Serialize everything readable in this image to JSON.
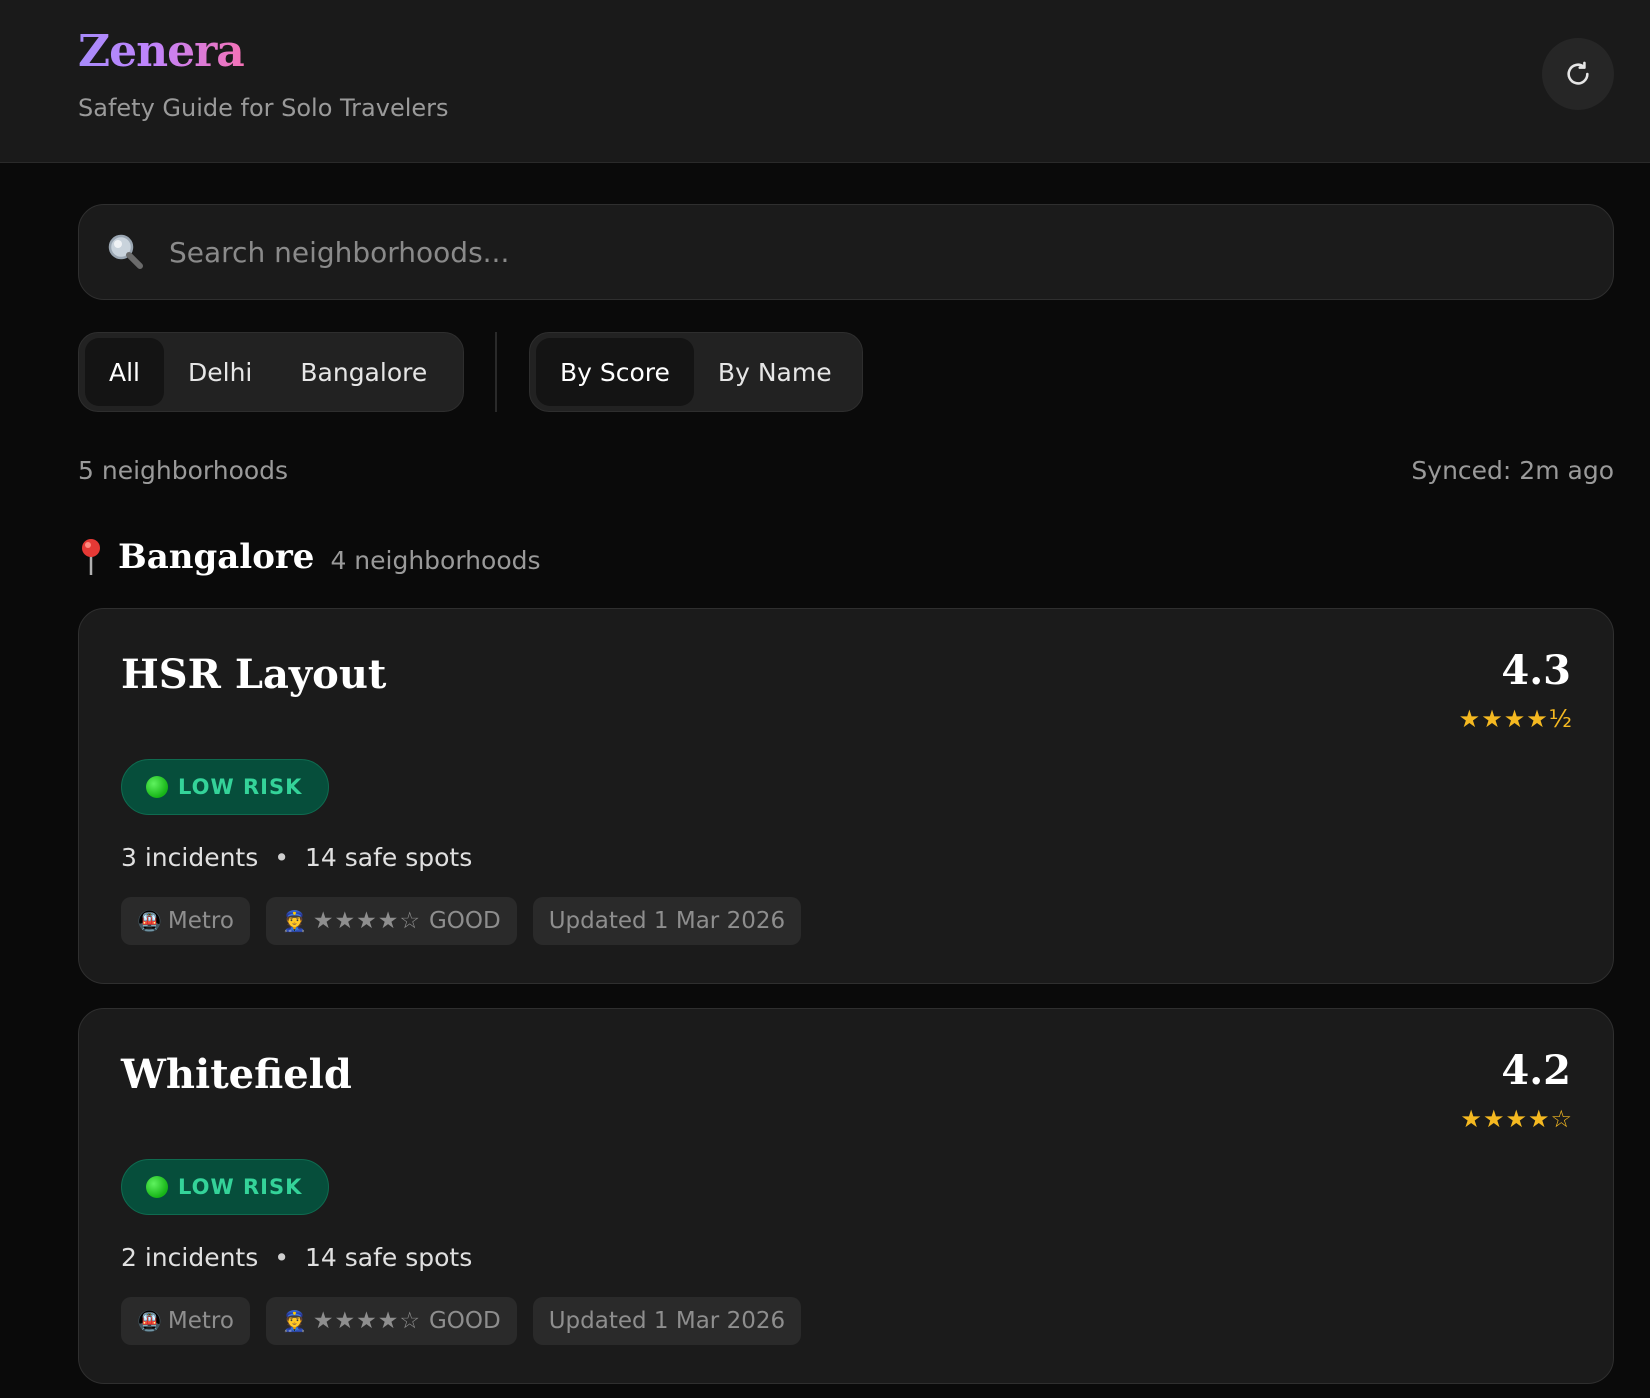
{
  "app": {
    "brand": "Zenera",
    "tagline": "Safety Guide for Solo Travelers"
  },
  "header": {
    "refresh_icon": "refresh-icon"
  },
  "search": {
    "placeholder": "Search neighborhoods...",
    "value": "",
    "icon": "search-icon"
  },
  "city_filter": {
    "options": [
      "All",
      "Delhi",
      "Bangalore"
    ],
    "selected": "All"
  },
  "sort_filter": {
    "options": [
      "By Score",
      "By Name"
    ],
    "selected": "By Score"
  },
  "summary": {
    "count_label": "5 neighborhoods",
    "synced_label": "Synced: 2m ago"
  },
  "group": {
    "city": "Bangalore",
    "count_label": "4 neighborhoods",
    "icon": "pin-icon"
  },
  "neighborhoods": [
    {
      "name": "HSR Layout",
      "score": "4.3",
      "stars": "★★★★½",
      "risk": "LOW RISK",
      "incidents": "3 incidents",
      "safe_spots": "14 safe spots",
      "transit": "Metro",
      "police_stars": "★★★★☆",
      "police_rating": "GOOD",
      "updated": "Updated 1 Mar 2026"
    },
    {
      "name": "Whitefield",
      "score": "4.2",
      "stars": "★★★★☆",
      "risk": "LOW RISK",
      "incidents": "2 incidents",
      "safe_spots": "14 safe spots",
      "transit": "Metro",
      "police_stars": "★★★★☆",
      "police_rating": "GOOD",
      "updated": "Updated 1 Mar 2026"
    }
  ],
  "colors": {
    "background": "#0a0a0a",
    "card": "#1b1b1b",
    "star": "#f5b921",
    "low_risk_bg": "#064e3b",
    "low_risk_text": "#34d399",
    "brand_gradient_start": "#a78bfa",
    "brand_gradient_end": "#f472b6"
  }
}
